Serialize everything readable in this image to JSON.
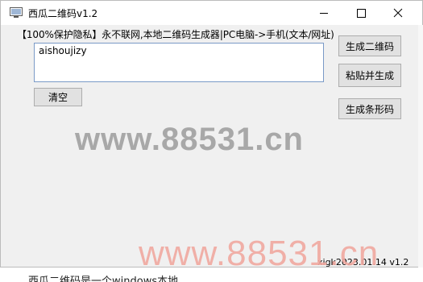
{
  "window": {
    "title": "西瓜二维码v1.2",
    "notice": "【100%保护隐私】永不联网,本地二维码生成器|PC电脑->手机(文本/网址)",
    "version": "xigk2023.01.14 v1.2"
  },
  "input": {
    "value": "aishoujizy"
  },
  "buttons": {
    "clear": "清空",
    "generate_qr": "生成二维码",
    "paste_generate": "粘贴并生成",
    "generate_barcode": "生成条形码"
  },
  "watermark": {
    "center": "www.88531.cn",
    "corner": "www.88531.cn"
  },
  "background": {
    "partial_text": "西瓜二维码是一个windows本地"
  },
  "icons": {
    "app": "app-icon",
    "minimize": "minimize-icon",
    "maximize": "maximize-icon",
    "close": "close-icon"
  }
}
